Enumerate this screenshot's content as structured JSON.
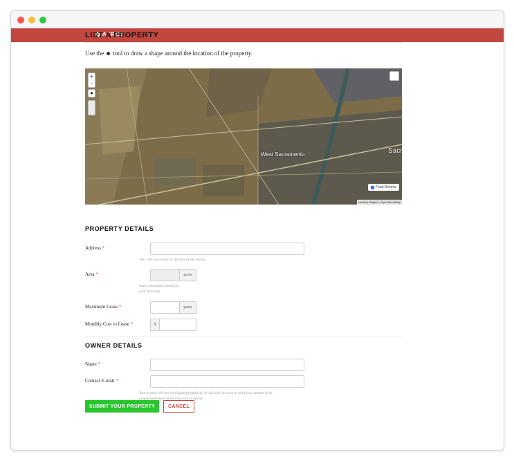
{
  "navbar": {
    "brand": "ACRES"
  },
  "page": {
    "title": "LIST A PROPERTY",
    "instructions_before": "Use the",
    "instructions_after": "tool to draw a shape around the location of the property."
  },
  "map": {
    "zoom_in": "+",
    "zoom_out": "-",
    "city_labels": [
      "West Sacramento",
      "Sacram"
    ],
    "legend_label": "Food Deserts",
    "attribution": "Leaflet | Mapbox | OpenStreetMap"
  },
  "property": {
    "section_title": "PROPERTY DETAILS",
    "address_label": "Address",
    "address_help": "This will also serve as the title of the listing.",
    "area_label": "Area",
    "area_unit": "acres",
    "area_help_1": "Auto-calculated based on",
    "area_help_2": "your drawing.",
    "lease_label": "Maximum Lease",
    "lease_unit": "years",
    "cost_label": "Monthly Cost to Lease",
    "cost_prefix": "$",
    "required_mark": "*"
  },
  "owner": {
    "section_title": "OWNER DETAILS",
    "name_label": "Name",
    "email_label": "Contact E-mail",
    "email_help_1": "Your e-mail will not be displayed publicly. It will only be used to send you updates from",
    "email_help_2": "people interested in leasing your property."
  },
  "actions": {
    "submit": "SUBMIT YOUR PROPERTY",
    "cancel": "CANCEL"
  }
}
